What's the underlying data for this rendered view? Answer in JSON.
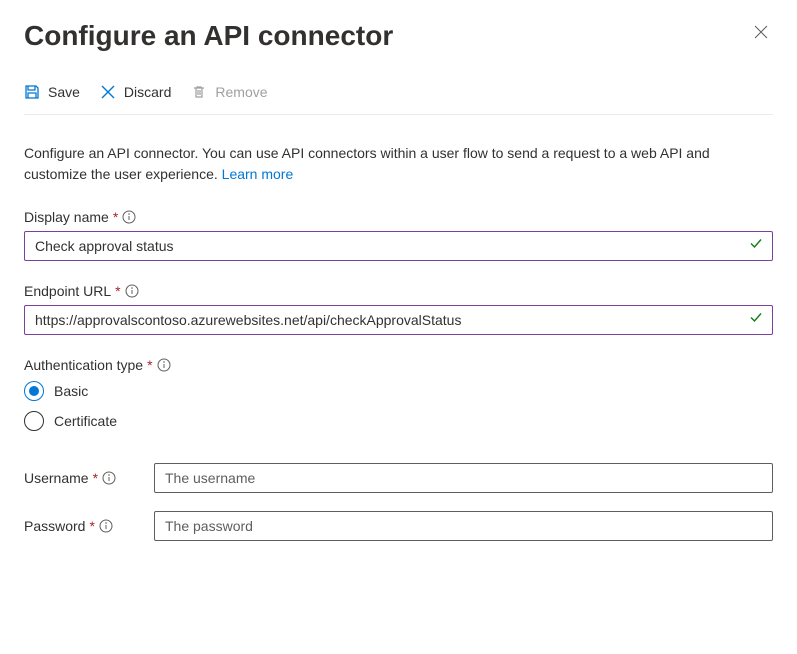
{
  "header": {
    "title": "Configure an API connector"
  },
  "toolbar": {
    "save_label": "Save",
    "discard_label": "Discard",
    "remove_label": "Remove"
  },
  "description": {
    "text": "Configure an API connector. You can use API connectors within a user flow to send a request to a web API and customize the user experience. ",
    "link_label": "Learn more"
  },
  "fields": {
    "display_name": {
      "label": "Display name",
      "value": "Check approval status"
    },
    "endpoint_url": {
      "label": "Endpoint URL",
      "value": "https://approvalscontoso.azurewebsites.net/api/checkApprovalStatus"
    },
    "auth_type": {
      "label": "Authentication type",
      "options": {
        "basic": "Basic",
        "certificate": "Certificate"
      }
    },
    "username": {
      "label": "Username",
      "placeholder": "The username"
    },
    "password": {
      "label": "Password",
      "placeholder": "The password"
    }
  }
}
